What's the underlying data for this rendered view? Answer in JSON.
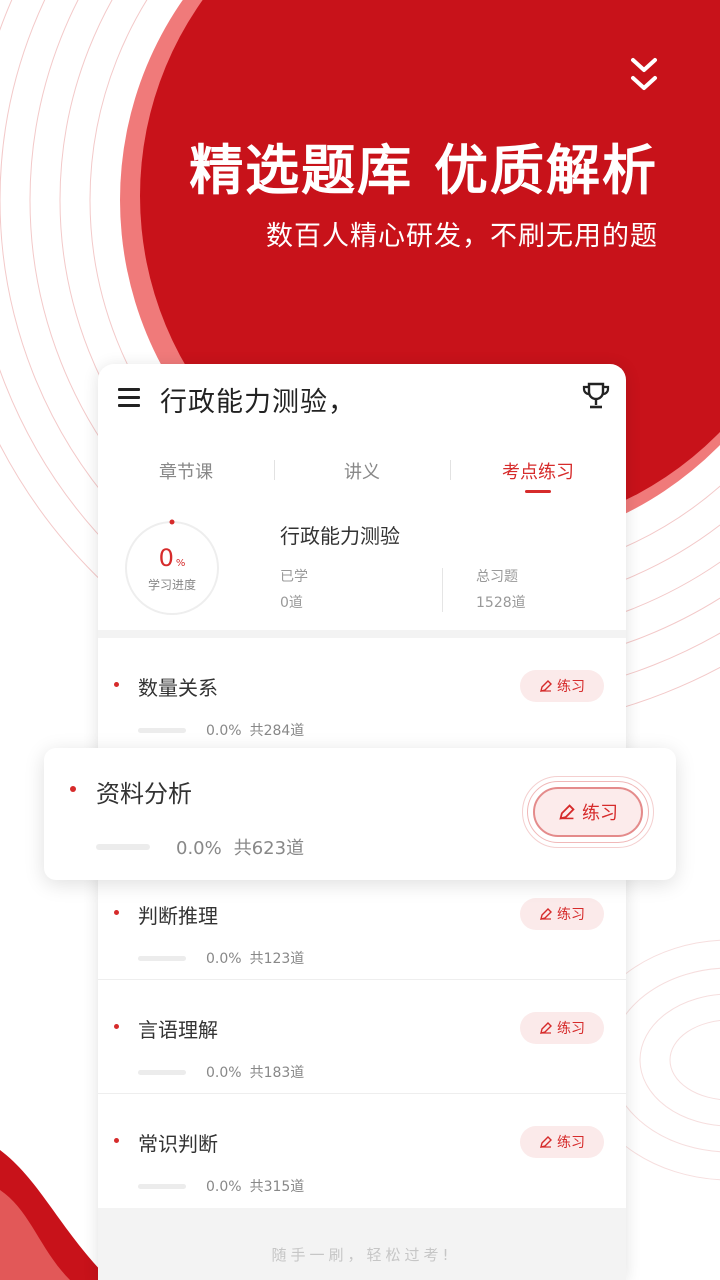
{
  "hero": {
    "headline": "精选题库 优质解析",
    "subline": "数百人精心研发，不刷无用的题"
  },
  "app": {
    "title": "行政能力测验，",
    "tabs": [
      {
        "label": "章节课",
        "active": false
      },
      {
        "label": "讲义",
        "active": false
      },
      {
        "label": "考点练习",
        "active": true
      }
    ]
  },
  "summary": {
    "progress_value": "0",
    "progress_unit": "%",
    "progress_label": "学习进度",
    "subject": "行政能力测验",
    "learned_label": "已学",
    "learned_value": "0道",
    "total_label": "总习题",
    "total_value": "1528道"
  },
  "topics": [
    {
      "name": "数量关系",
      "percent": "0.0%",
      "count": "共284道",
      "button": "练习"
    },
    {
      "name": "资料分析",
      "percent": "0.0%",
      "count": "共623道",
      "button": "练习"
    },
    {
      "name": "判断推理",
      "percent": "0.0%",
      "count": "共123道",
      "button": "练习"
    },
    {
      "name": "言语理解",
      "percent": "0.0%",
      "count": "共183道",
      "button": "练习"
    },
    {
      "name": "常识判断",
      "percent": "0.0%",
      "count": "共315道",
      "button": "练习"
    }
  ],
  "footer": {
    "slogan": "随手一刷，轻松过考!"
  },
  "colors": {
    "brand_red": "#c8121a",
    "accent_red": "#d62b2b"
  },
  "icons": [
    "chevron-double-down-icon",
    "menu-icon",
    "trophy-icon",
    "pen-icon"
  ]
}
